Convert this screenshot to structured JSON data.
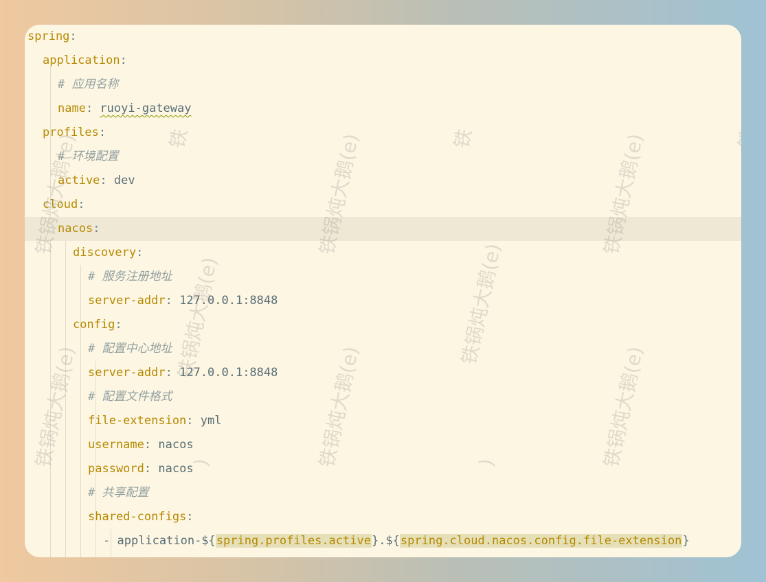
{
  "editor": {
    "lines": [
      {
        "key": "spring",
        "sep": ":",
        "value": ""
      },
      {
        "key": "application",
        "sep": ":",
        "value": ""
      },
      {
        "comment": "# ",
        "text": "应用名称"
      },
      {
        "key": "name",
        "sep": ": ",
        "value": "ruoyi-gateway"
      },
      {
        "key": "profiles",
        "sep": ":",
        "value": ""
      },
      {
        "comment": "# ",
        "text": "环境配置"
      },
      {
        "key": "active",
        "sep": ": ",
        "value": "dev"
      },
      {
        "key": "cloud",
        "sep": ":",
        "value": ""
      },
      {
        "key": "nacos",
        "sep": ":",
        "value": ""
      },
      {
        "key": "discovery",
        "sep": ":",
        "value": ""
      },
      {
        "comment": "# ",
        "text": "服务注册地址"
      },
      {
        "key": "server-addr",
        "sep": ": ",
        "value": "127.0.0.1:8848"
      },
      {
        "key": "config",
        "sep": ":",
        "value": ""
      },
      {
        "comment": "# ",
        "text": "配置中心地址"
      },
      {
        "key": "server-addr",
        "sep": ": ",
        "value": "127.0.0.1:8848"
      },
      {
        "comment": "# ",
        "text": "配置文件格式"
      },
      {
        "key": "file-extension",
        "sep": ": ",
        "value": "yml"
      },
      {
        "key": "username",
        "sep": ": ",
        "value": "nacos"
      },
      {
        "key": "password",
        "sep": ": ",
        "value": "nacos"
      },
      {
        "comment": "# ",
        "text": "共享配置"
      },
      {
        "key": "shared-configs",
        "sep": ":",
        "value": ""
      },
      {
        "dash": "- ",
        "prefix": "application-${",
        "hl1": "spring.profiles.active",
        "mid": "}.${",
        "hl2": "spring.cloud.nacos.config.file-extension",
        "suffix": "}"
      }
    ]
  },
  "watermark": {
    "text": "铁锅炖大鹅(e)",
    "fragment": "铁",
    "paren": ")"
  }
}
